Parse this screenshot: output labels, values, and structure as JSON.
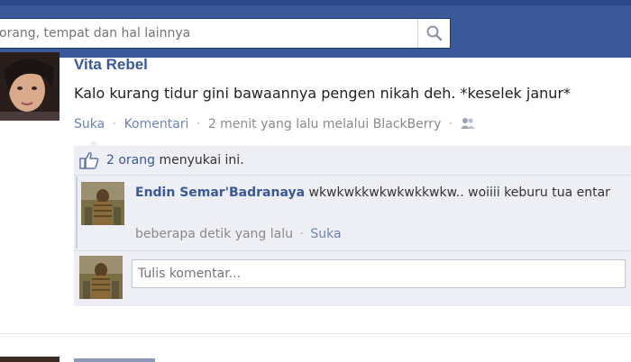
{
  "search": {
    "placeholder": "orang, tempat dan hal lainnya"
  },
  "post": {
    "author": "Vita Rebel",
    "text": "Kalo kurang tidur gini bawaannya pengen nikah deh. *keselek janur*",
    "actions": {
      "like": "Suka",
      "comment": "Komentari",
      "time": "2 menit yang lalu melalui BlackBerry"
    }
  },
  "likes": {
    "count": "2 orang",
    "suffix": " menyukai ini."
  },
  "comment": {
    "author": "Endin Semar'Badranaya",
    "text": "wkwkwkkwkwkwkkwkw.. woiiii keburu tua entar",
    "time": "beberapa detik yang lalu",
    "like": "Suka"
  },
  "reply": {
    "placeholder": "Tulis komentar..."
  },
  "colors": {
    "header": "#3b5998",
    "link": "#3b5998",
    "ufi_bg": "#edeff4"
  }
}
